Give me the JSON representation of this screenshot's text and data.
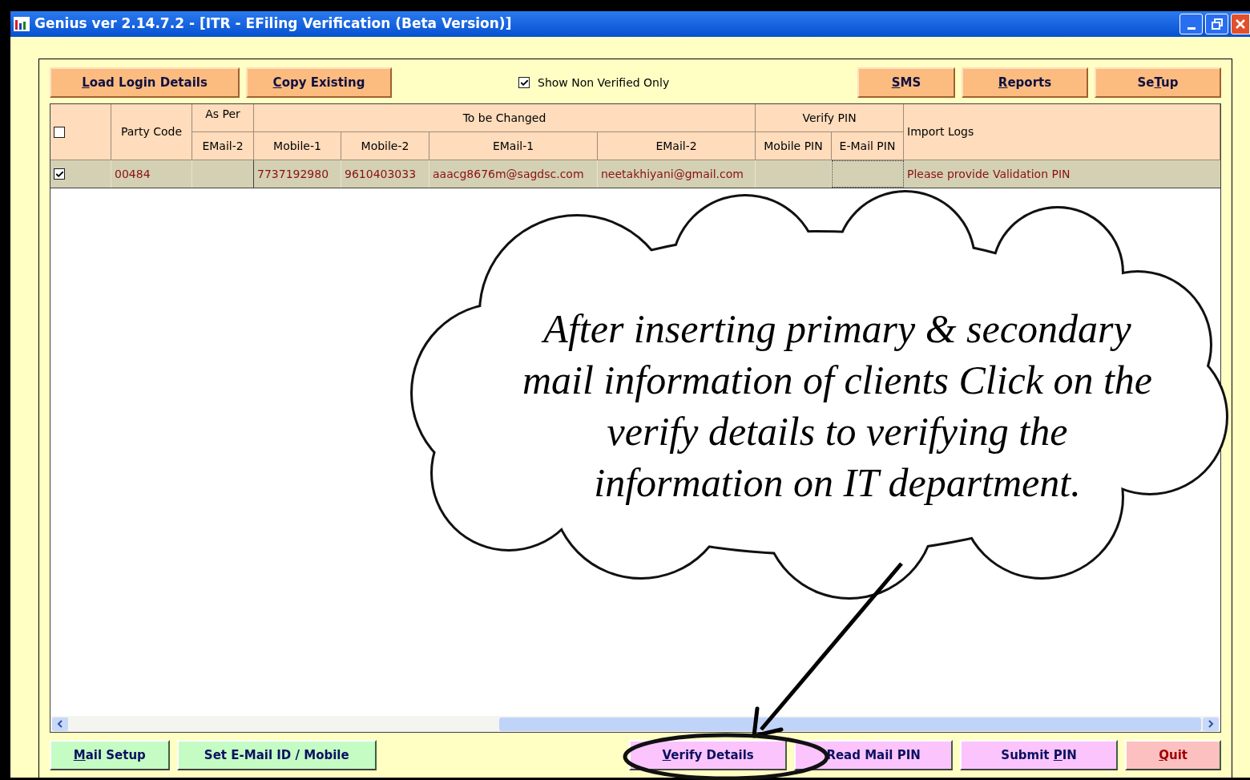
{
  "window": {
    "title": "Genius ver 2.14.7.2 - [ITR - EFiling Verification (Beta Version)]"
  },
  "toolbar": {
    "left_buttons": [
      {
        "key": "L",
        "post": "oad Login Details"
      },
      {
        "key": "C",
        "post": "opy Existing"
      }
    ],
    "filter": {
      "label": "Show Non Verified Only",
      "checked": true
    },
    "right_buttons": [
      {
        "key": "S",
        "post": "MS"
      },
      {
        "key": "R",
        "post": "eports"
      },
      {
        "pre": "Se",
        "key": "T",
        "post": "up"
      }
    ]
  },
  "table": {
    "select_all_checked": false,
    "headers": {
      "party_code": "Party Code",
      "as_per": "As Per",
      "to_be_changed": "To be Changed",
      "verify_pin": "Verify PIN",
      "import_logs": "Import Logs",
      "sub_columns": [
        "EMail-2",
        "Mobile-1",
        "Mobile-2",
        "EMail-1",
        "EMail-2",
        "Mobile PIN",
        "E-Mail PIN"
      ]
    },
    "rows": [
      {
        "checked": true,
        "party_code": "00484",
        "mobile_1": "7737192980",
        "mobile_2": "9610403033",
        "email_1": "aaacg8676m@sagdsc.com",
        "email_2": "neetakhiyani@gmail.com",
        "log": "Please provide Validation PIN"
      }
    ]
  },
  "bottom_buttons": [
    {
      "kind": "green",
      "highlighted": false,
      "key": "M",
      "post": "ail Setup"
    },
    {
      "kind": "green",
      "highlighted": false,
      "pre": "Set E-Mail ID / Mobile"
    },
    {
      "kind": "pink",
      "highlighted": true,
      "key": "V",
      "post": "erify Details"
    },
    {
      "kind": "pink",
      "highlighted": false,
      "pre": "Read Mail PIN"
    },
    {
      "kind": "pink",
      "highlighted": false,
      "pre": "Submit ",
      "key": "P",
      "post": "IN"
    },
    {
      "kind": "red",
      "highlighted": false,
      "key": "Q",
      "post": "uit"
    }
  ],
  "callout": {
    "text": "After inserting primary & secondary mail information of clients Click on the verify details to verifying the information on IT department."
  }
}
